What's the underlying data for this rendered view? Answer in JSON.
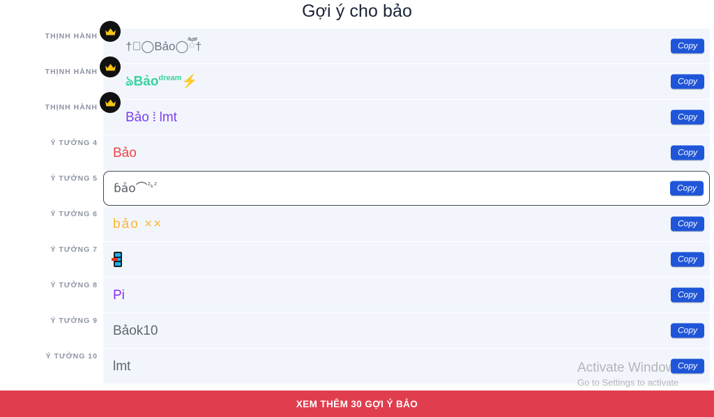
{
  "page": {
    "title": "Gợi ý cho bảo"
  },
  "colors": {
    "row_bg": "#f2f6fc",
    "copy_btn": "#1f55d8",
    "bottom_bar": "#e03e4e",
    "title": "#1b2437",
    "label": "#8c93a3"
  },
  "copy_label": "Copy",
  "rows": [
    {
      "label": "THỊNH HÀNH",
      "badge": "crown-badge",
      "name": "†ཽ◯Bảo◯ཽ†",
      "style": "outline",
      "focused": false
    },
    {
      "label": "THỊNH HÀNH",
      "badge": "crown-badge",
      "name": "ঌBảo",
      "sup": "dream",
      "suffix": "⚡",
      "style": "green",
      "focused": false
    },
    {
      "label": "THỊNH HÀNH",
      "badge": "crown-badge",
      "name": "Bảo ⦙ lmt",
      "style": "purple",
      "focused": false
    },
    {
      "label": "Ý TƯỞNG 4",
      "badge": null,
      "name": "Bảo",
      "style": "red",
      "focused": false
    },
    {
      "label": "Ý TƯỞNG 5",
      "badge": null,
      "name": "ɓảo⌒",
      "sup": "²ₖ²",
      "style": "mono",
      "focused": true
    },
    {
      "label": "Ý TƯỞNG 6",
      "badge": null,
      "name": "bảo ××",
      "style": "amber",
      "focused": false
    },
    {
      "label": "Ý TƯỞNG 7",
      "badge": null,
      "name": "",
      "icon": "mobile-phone-with-arrow-icon",
      "style": "emoji",
      "focused": false
    },
    {
      "label": "Ý TƯỞNG 8",
      "badge": null,
      "name": "Pi",
      "style": "violet",
      "focused": false
    },
    {
      "label": "Ý TƯỞNG 9",
      "badge": null,
      "name": "Bảok10",
      "style": "gray",
      "focused": false
    },
    {
      "label": "Ý TƯỞNG 10",
      "badge": null,
      "name": "lmt",
      "style": "gray",
      "focused": false
    }
  ],
  "watermark": {
    "line1": "Activate Windows",
    "line2": "Go to Settings to activate Windows"
  },
  "bottom_bar": {
    "label": "XEM THÊM 30 GỢI Ý BẢO"
  }
}
